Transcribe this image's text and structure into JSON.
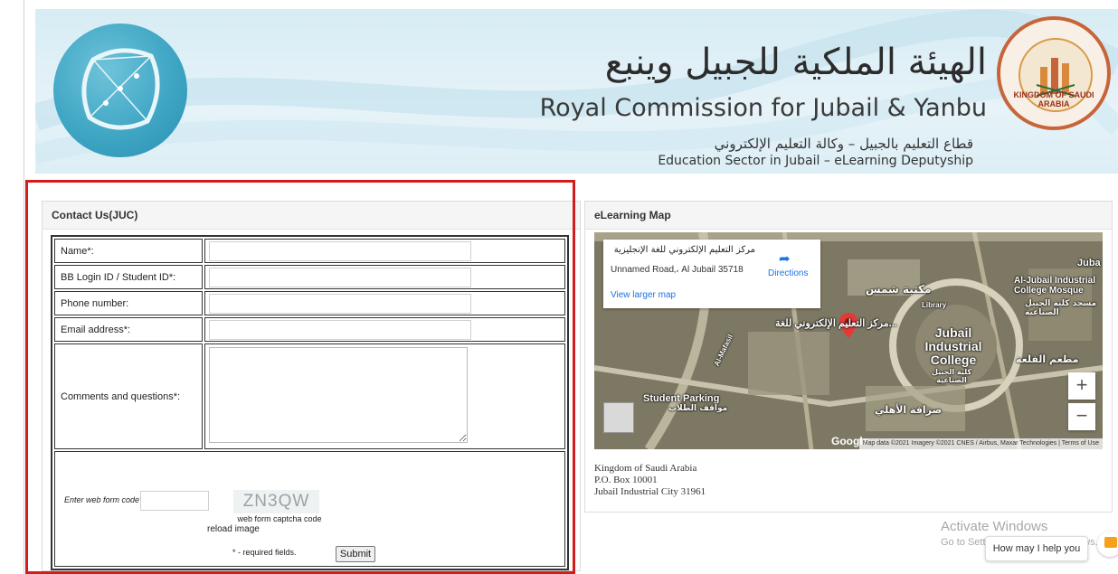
{
  "banner": {
    "title_ar": "الهيئة الملكية للجبيل وينبع",
    "title_en": "Royal Commission for Jubail & Yanbu",
    "subtitle_ar": "قطاع التعليم بالجبيل – وكالة التعليم الإلكتروني",
    "subtitle_en": "Education Sector in Jubail – eLearning Deputyship",
    "emblem_text": "KINGDOM OF SAUDI ARABIA",
    "colors": {
      "banner_bg": "#dceef5",
      "emblem_ring": "#c7653a",
      "logo_blue": "#3fa6c4"
    }
  },
  "contact": {
    "heading": "Contact Us(JUC)",
    "fields": [
      {
        "label": "Name*:",
        "value": ""
      },
      {
        "label": "BB Login ID / Student ID*:",
        "value": ""
      },
      {
        "label": "Phone number:",
        "value": ""
      },
      {
        "label": "Email address*:",
        "value": ""
      }
    ],
    "comments_label": "Comments and questions*:",
    "comments_value": "",
    "captcha": {
      "label": "Enter web form code*:",
      "code": "ZN3QW",
      "caption": "web form captcha code",
      "reload": "reload image"
    },
    "required_note": "* - required fields.",
    "submit_label": "Submit",
    "highlight_color": "#d21d1d"
  },
  "map_panel": {
    "heading": "eLearning Map",
    "card": {
      "title": "مركز التعليم الإلكتروني للغة الإنجليزية",
      "address": "Unnamed Road‚، Al Jubail 35718",
      "directions": "Directions",
      "larger_map": "View larger map"
    },
    "labels": {
      "library_ar": "مكتبة شمس",
      "library_en": "Library",
      "mosque": "Al-Jubail Industrial College Mosque",
      "mosque_ar": "مسجد كلية الجبيل الصناعية",
      "college": "Jubail Industrial College",
      "college_ar": "كلية الجبيل الصناعية",
      "center": "مركز التعليم الإلكتروني للغة...",
      "parking": "Student Parking",
      "parking_ar": "مواقف الطلاب",
      "restaurant": "مطعم الفلعة",
      "bank": "صرافة الأهلي",
      "juba": "Juba",
      "road": "Al-Mafasil"
    },
    "zoom_in": "+",
    "zoom_out": "−",
    "google": "Google",
    "attribution": "Map data ©2021 Imagery ©2021 CNES / Airbus, Maxar Technologies",
    "terms": "Terms of Use",
    "address_lines": [
      "Kingdom of Saudi Arabia",
      "P.O. Box 10001",
      "Jubail Industrial City 31961"
    ]
  },
  "overlay": {
    "activate_title": "Activate Windows",
    "activate_sub": "Go to Settings to activate Windows.",
    "chat_label": "How may I help you",
    "chat_icon": "chat-bubble-icon"
  }
}
